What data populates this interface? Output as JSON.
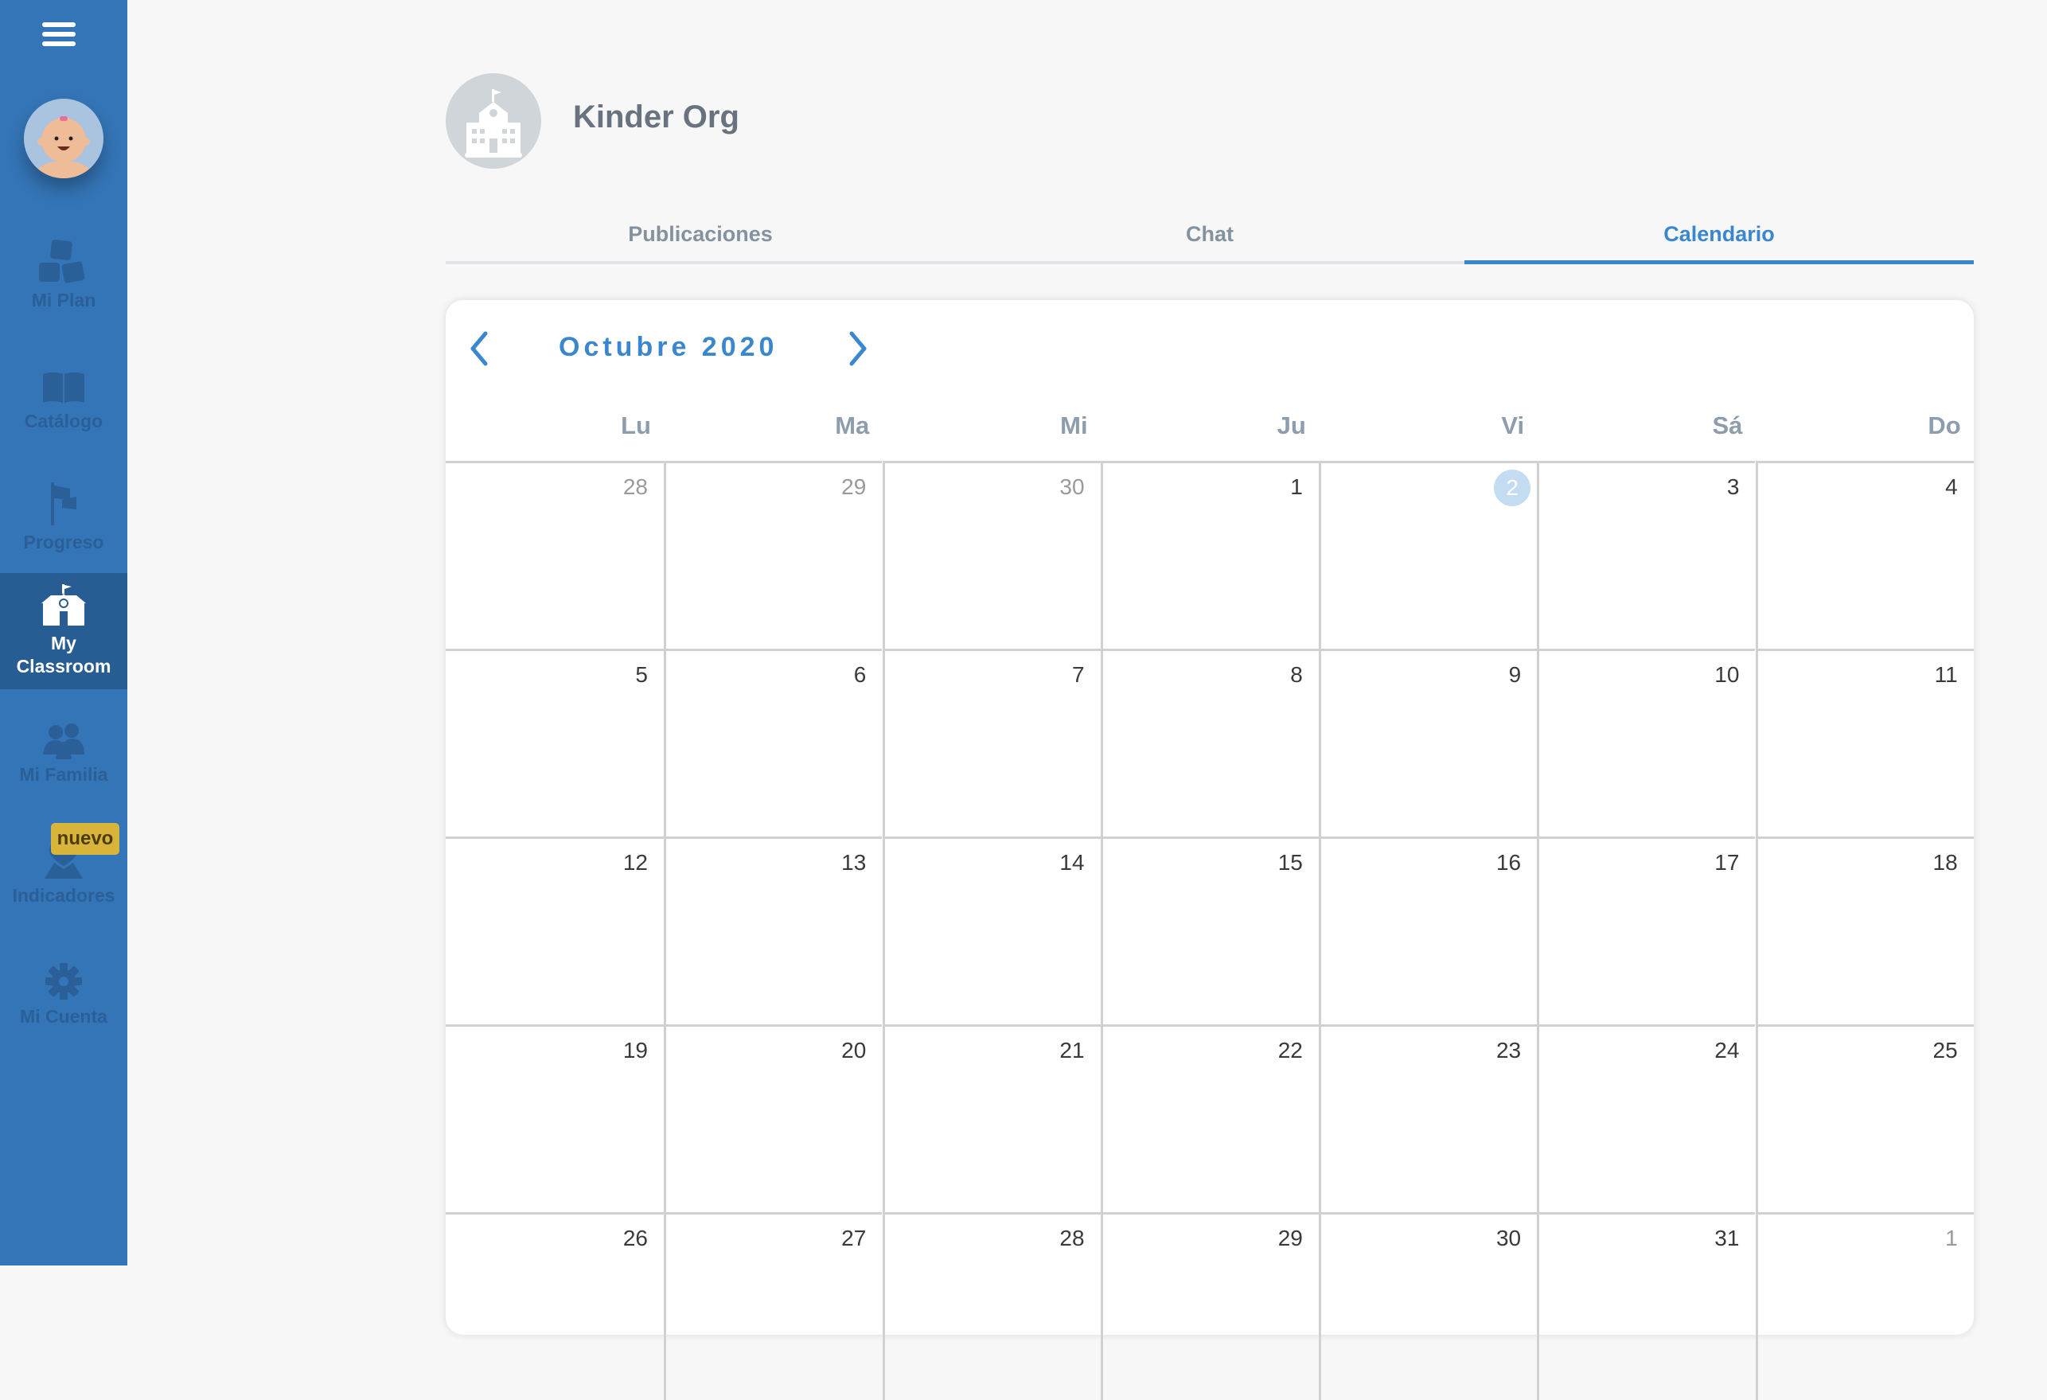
{
  "sidebar": {
    "menu_icon": "hamburger-icon",
    "avatar": "baby-avatar",
    "items": [
      {
        "label": "Mi Plan",
        "icon": "abc-blocks-icon",
        "active": false
      },
      {
        "label": "Catálogo",
        "icon": "book-icon",
        "active": false
      },
      {
        "label": "Progreso",
        "icon": "flag-icon",
        "active": false
      },
      {
        "label": "My Classroom",
        "label_line1": "My",
        "label_line2": "Classroom",
        "icon": "school-icon",
        "active": true
      },
      {
        "label": "Mi Familia",
        "icon": "family-icon",
        "active": false
      },
      {
        "label": "Indicadores",
        "icon": "location-pin-icon",
        "active": false,
        "badge": "nuevo"
      },
      {
        "label": "Mi Cuenta",
        "icon": "gear-icon",
        "active": false
      }
    ]
  },
  "header": {
    "org_name": "Kinder Org",
    "org_icon": "school-icon"
  },
  "tabs": [
    {
      "label": "Publicaciones",
      "active": false
    },
    {
      "label": "Chat",
      "active": false
    },
    {
      "label": "Calendario",
      "active": true
    }
  ],
  "calendar": {
    "title": "Octubre 2020",
    "prev_icon": "chevron-left-icon",
    "next_icon": "chevron-right-icon",
    "weekdays": [
      "Lu",
      "Ma",
      "Mi",
      "Ju",
      "Vi",
      "Sá",
      "Do"
    ],
    "today": 2,
    "weeks": [
      [
        {
          "d": "28",
          "other": true
        },
        {
          "d": "29",
          "other": true
        },
        {
          "d": "30",
          "other": true
        },
        {
          "d": "1"
        },
        {
          "d": "2",
          "today": true
        },
        {
          "d": "3"
        },
        {
          "d": "4"
        }
      ],
      [
        {
          "d": "5"
        },
        {
          "d": "6"
        },
        {
          "d": "7"
        },
        {
          "d": "8"
        },
        {
          "d": "9"
        },
        {
          "d": "10"
        },
        {
          "d": "11"
        }
      ],
      [
        {
          "d": "12"
        },
        {
          "d": "13"
        },
        {
          "d": "14"
        },
        {
          "d": "15"
        },
        {
          "d": "16"
        },
        {
          "d": "17"
        },
        {
          "d": "18"
        }
      ],
      [
        {
          "d": "19"
        },
        {
          "d": "20"
        },
        {
          "d": "21"
        },
        {
          "d": "22"
        },
        {
          "d": "23"
        },
        {
          "d": "24"
        },
        {
          "d": "25"
        }
      ],
      [
        {
          "d": "26"
        },
        {
          "d": "27"
        },
        {
          "d": "28"
        },
        {
          "d": "29"
        },
        {
          "d": "30"
        },
        {
          "d": "31"
        },
        {
          "d": "1",
          "other": true
        }
      ]
    ]
  },
  "colors": {
    "sidebar": "#3475b7",
    "sidebar_active": "#285d93",
    "accent": "#3a86cf",
    "badge": "#d9b43a",
    "today_bg": "#c3dcf2"
  }
}
